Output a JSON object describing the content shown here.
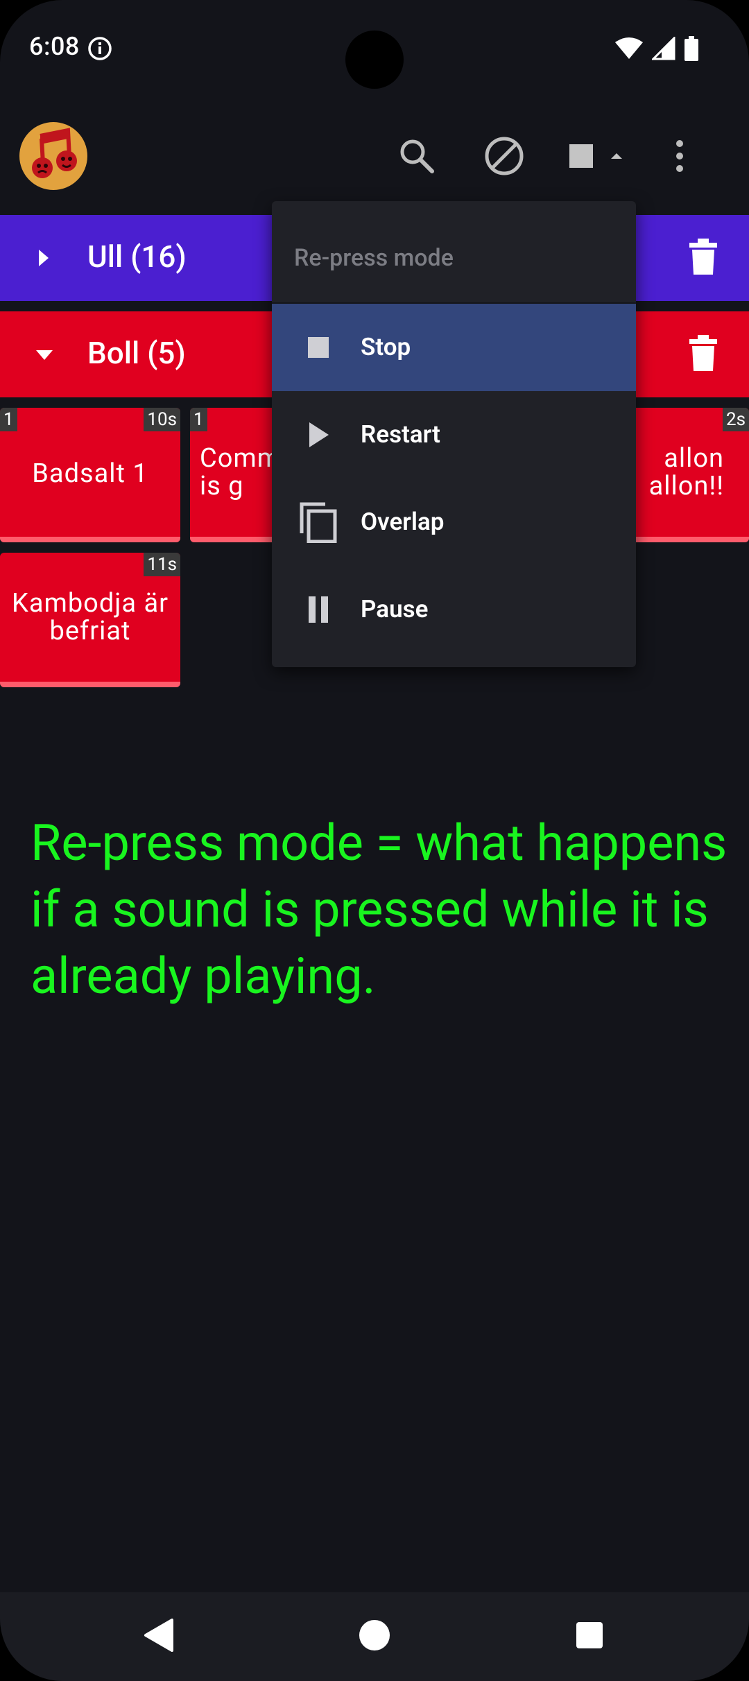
{
  "status": {
    "time": "6:08"
  },
  "toolbar": {
    "logo_icon": "theater-masks-music-note-icon",
    "search_icon": "search-icon",
    "block_icon": "block-icon",
    "mode_icon": "stop-square-icon",
    "overflow_icon": "more-vert-icon"
  },
  "categories": [
    {
      "title": "Ull (16)",
      "color": "#4b1fd0",
      "expanded": false
    },
    {
      "title": "Boll (5)",
      "color": "#e0001f",
      "expanded": true
    }
  ],
  "sounds": [
    {
      "label": "Badsalt 1",
      "left_badge": "1",
      "right_badge": "10s"
    },
    {
      "label": "Comm\nis g",
      "left_badge": "1",
      "right_badge": ""
    },
    {
      "label": "allon\nallon!!",
      "left_badge": "",
      "right_badge": "2s"
    },
    {
      "label": "Kambodja är\nbefriat",
      "left_badge": "",
      "right_badge": "11s"
    }
  ],
  "menu": {
    "header": "Re-press mode",
    "items": [
      {
        "label": "Stop",
        "icon": "stop-icon",
        "selected": true
      },
      {
        "label": "Restart",
        "icon": "play-icon",
        "selected": false
      },
      {
        "label": "Overlap",
        "icon": "copy-icon",
        "selected": false
      },
      {
        "label": "Pause",
        "icon": "pause-icon",
        "selected": false
      }
    ]
  },
  "hint": "Re-press mode = what happens if a sound is pressed while it is already playing.",
  "colors": {
    "accent_green": "#19f51f",
    "background": "#13141a",
    "menu_selected": "#33467c"
  }
}
